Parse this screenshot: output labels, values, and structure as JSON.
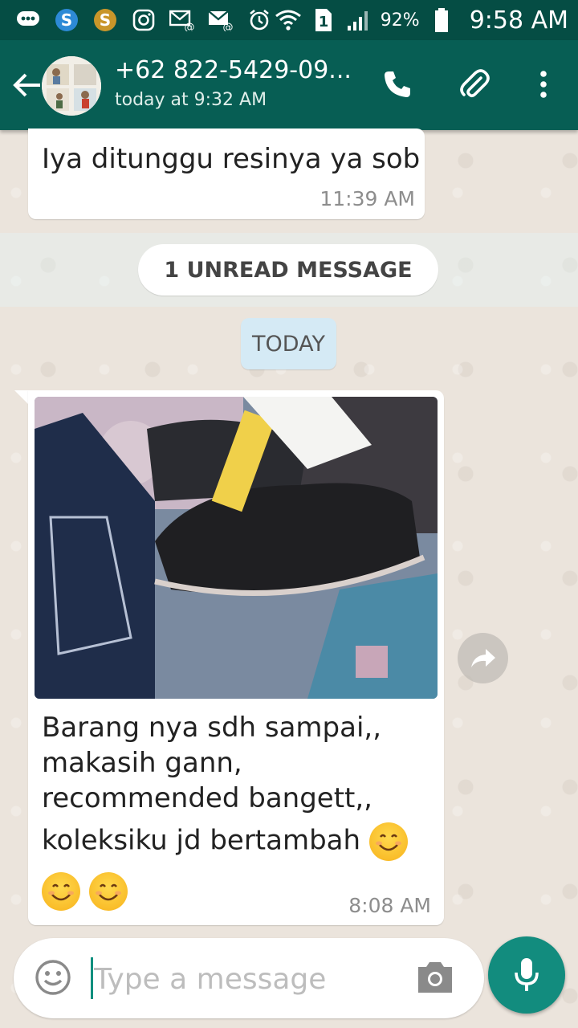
{
  "status_bar": {
    "battery_percent": "92%",
    "time": "9:58 AM",
    "sim_indicator": "1",
    "icons": [
      "chat-bubble-icon",
      "skype-icon",
      "skype-alt-icon",
      "instagram-icon",
      "email-at-icon",
      "email-at-icon",
      "alarm-icon",
      "wifi-icon",
      "sim-icon",
      "signal-icon",
      "battery-icon"
    ]
  },
  "app_bar": {
    "contact_name": "+62 822-5429-09...",
    "last_seen": "today at 9:32 AM",
    "icons": [
      "back-arrow-icon",
      "phone-icon",
      "paperclip-icon",
      "more-vert-icon"
    ]
  },
  "messages": [
    {
      "text": "Iya ditunggu resinya ya sob",
      "time": "11:39 AM"
    },
    {
      "caption_lines": [
        "Barang nya sdh sampai,,",
        "makasih gann,",
        "recommended bangett,,",
        "koleksiku jd bertambah"
      ],
      "time": "8:08 AM"
    }
  ],
  "unread_banner": "1 UNREAD MESSAGE",
  "date_divider": "TODAY",
  "input": {
    "placeholder": "Type a message"
  },
  "colors": {
    "header": "#075e54",
    "status": "#054d44",
    "accent": "#128c7e"
  }
}
